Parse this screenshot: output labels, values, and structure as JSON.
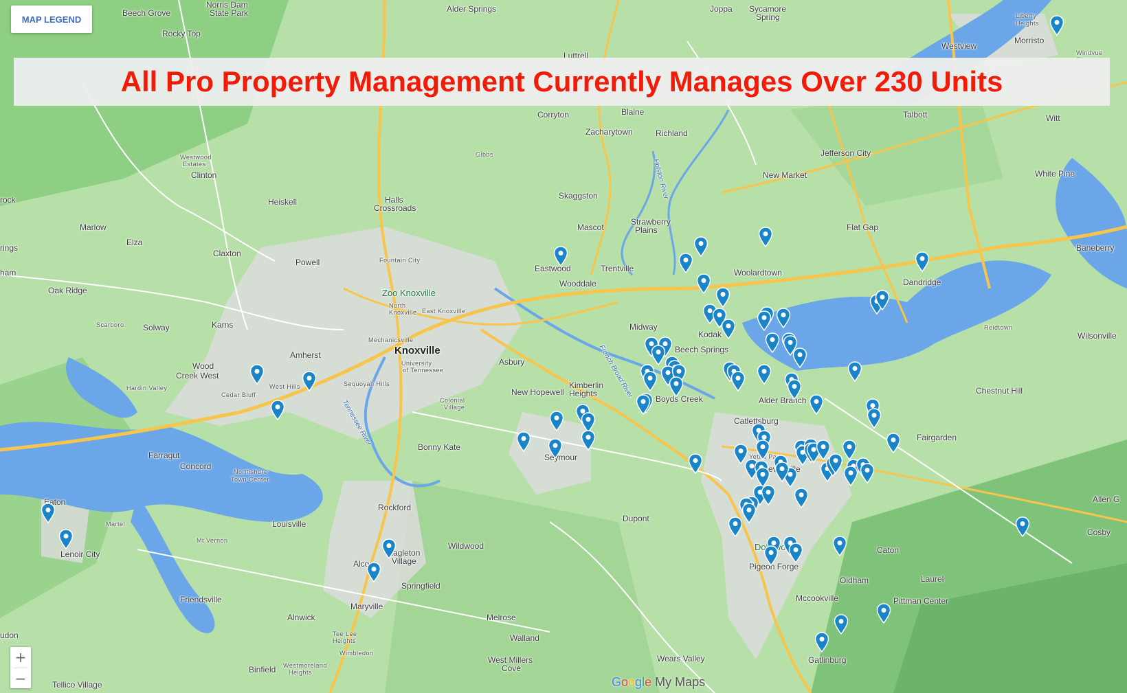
{
  "legend_button": "MAP LEGEND",
  "title": "All Pro Property Management Currently Manages Over 230 Units",
  "zoom": {
    "in": "+",
    "out": "−"
  },
  "attribution": {
    "brand": [
      "G",
      "o",
      "o",
      "g",
      "l",
      "e"
    ],
    "product": " My Maps"
  },
  "colors": {
    "title": "#f01c08",
    "pin": "#1a84c8",
    "legend": "#3b6fbf"
  },
  "places": [
    "Beech Grove",
    "Norris Dam",
    "State Park",
    "Rocky Top",
    "Alder Springs",
    "Joppa",
    "Sycamore",
    "Spring",
    "Luttrell",
    "Liberty",
    "Heights",
    "Morristo",
    "Westview",
    "Windvue",
    "Estates",
    "Corryton",
    "Blaine",
    "Zacharytown",
    "Richland",
    "Talbott",
    "Witt",
    "Jefferson City",
    "New Market",
    "White Pine",
    "Westwood",
    "Estates",
    "Clinton",
    "Gibbs",
    "Halls",
    "Crossroads",
    "Skaggston",
    "Heiskell",
    "Marlow",
    "Mascot",
    "Strawberry",
    "Plains",
    "Flat Gap",
    "Baneberry",
    "Elza",
    "rings",
    "Claxton",
    "Fountain City",
    "Powell",
    "Eastwood",
    "Trentville",
    "Woolardtown",
    "Oak Ridge",
    "Wooddale",
    "Zoo Knoxville",
    "North",
    "Knoxville",
    "East Knoxville",
    "Dandridge",
    "Scarboro",
    "Solway",
    "Karns",
    "Midway",
    "Kodak",
    "Reidtown",
    "Wilsonville",
    "Mechanicsville",
    "Knoxville",
    "Beech Springs",
    "Amherst",
    "University",
    "of Tennessee",
    "Asbury",
    "Wood",
    "Creek West",
    "Hardin Valley",
    "Cedar Bluff",
    "West Hills",
    "Sequoyah Hills",
    "Kimberlin",
    "Heights",
    "New Hopewell",
    "Boyds Creek",
    "Alder Branch",
    "Chestnut Hill",
    "Colonial",
    "Village",
    "Catlettsburg",
    "Farragut",
    "Bonny Kate",
    "Seymour",
    "Fairgarden",
    "Concord",
    "Northshore",
    "Town Center",
    "Yettla Park",
    "Sevierville",
    "Eaton",
    "Rockford",
    "Dupont",
    "Allen G",
    "Martel",
    "Louisville",
    "Mt Vernon",
    "Cosby",
    "Lenoir City",
    "Eagleton",
    "Village",
    "Wildwood",
    "Dollywood",
    "Pigeon Forge",
    "Caton",
    "Alcoa",
    "Springfield",
    "Oldham",
    "Laurel",
    "Friendsville",
    "Maryville",
    "Mccookville",
    "Pittman Center",
    "udon",
    "Alnwick",
    "Melrose",
    "Tee Lee",
    "Heights",
    "Walland",
    "Wimbledon",
    "West Millers",
    "Cove",
    "Wears Valley",
    "Gatlinburg",
    "Binfield",
    "Westmoreland",
    "Heights",
    "Tellico Village",
    "French Broad River",
    "Holston River",
    "Tennessee River",
    "rock",
    "ham"
  ]
}
